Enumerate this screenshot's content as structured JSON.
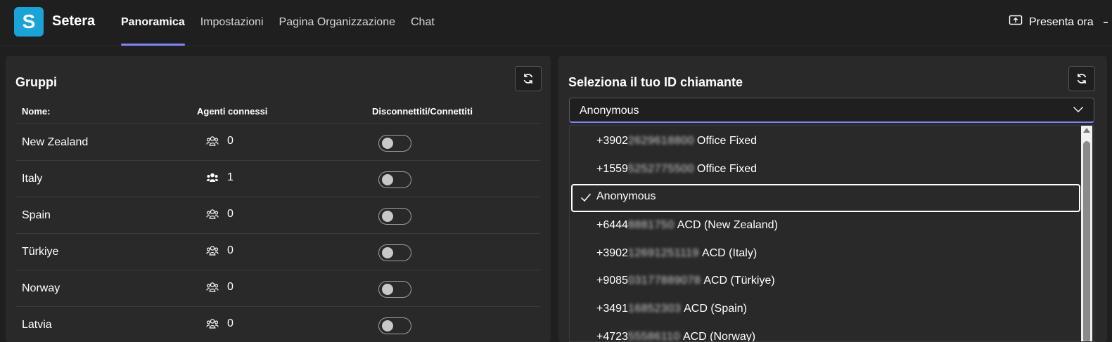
{
  "app": {
    "logo_letter": "S",
    "name": "Setera",
    "accent": "#7f85f5",
    "logo_color": "#1aa3d6"
  },
  "nav": {
    "tabs": [
      {
        "label": "Panoramica",
        "active": true
      },
      {
        "label": "Impostazioni",
        "active": false
      },
      {
        "label": "Pagina Organizzazione",
        "active": false
      },
      {
        "label": "Chat",
        "active": false
      }
    ]
  },
  "header": {
    "present_label": "Presenta ora",
    "present_icon": "share-screen-icon"
  },
  "groups": {
    "title": "Gruppi",
    "refresh_icon": "refresh-icon",
    "columns": {
      "name": "Nome:",
      "agents": "Agenti connessi",
      "toggle": "Disconnettiti/Connettiti"
    },
    "rows": [
      {
        "name": "New Zealand",
        "agents": "0",
        "connected": false
      },
      {
        "name": "Italy",
        "agents": "1",
        "connected": false
      },
      {
        "name": "Spain",
        "agents": "0",
        "connected": false
      },
      {
        "name": "Türkiye",
        "agents": "0",
        "connected": false
      },
      {
        "name": "Norway",
        "agents": "0",
        "connected": false
      },
      {
        "name": "Latvia",
        "agents": "0",
        "connected": false
      }
    ]
  },
  "caller_id": {
    "title": "Seleziona il tuo ID chiamante",
    "selected": "Anonymous",
    "options": [
      {
        "prefix": "+3902",
        "hidden": "2629618800",
        "label": "Office Fixed",
        "selected": false
      },
      {
        "prefix": "+1559",
        "hidden": "5252775500",
        "label": "Office Fixed",
        "selected": false
      },
      {
        "prefix": "",
        "hidden": "",
        "label": "Anonymous",
        "selected": true
      },
      {
        "prefix": "+6444",
        "hidden": "8881750",
        "label": "ACD (New Zealand)",
        "selected": false
      },
      {
        "prefix": "+3902",
        "hidden": "12691251119",
        "label": "ACD (Italy)",
        "selected": false
      },
      {
        "prefix": "+9085",
        "hidden": "03177889078",
        "label": "ACD (Türkiye)",
        "selected": false
      },
      {
        "prefix": "+3491",
        "hidden": "16852303",
        "label": "ACD (Spain)",
        "selected": false
      },
      {
        "prefix": "+4723",
        "hidden": "55586110",
        "label": "ACD (Norway)",
        "selected": false
      }
    ]
  }
}
